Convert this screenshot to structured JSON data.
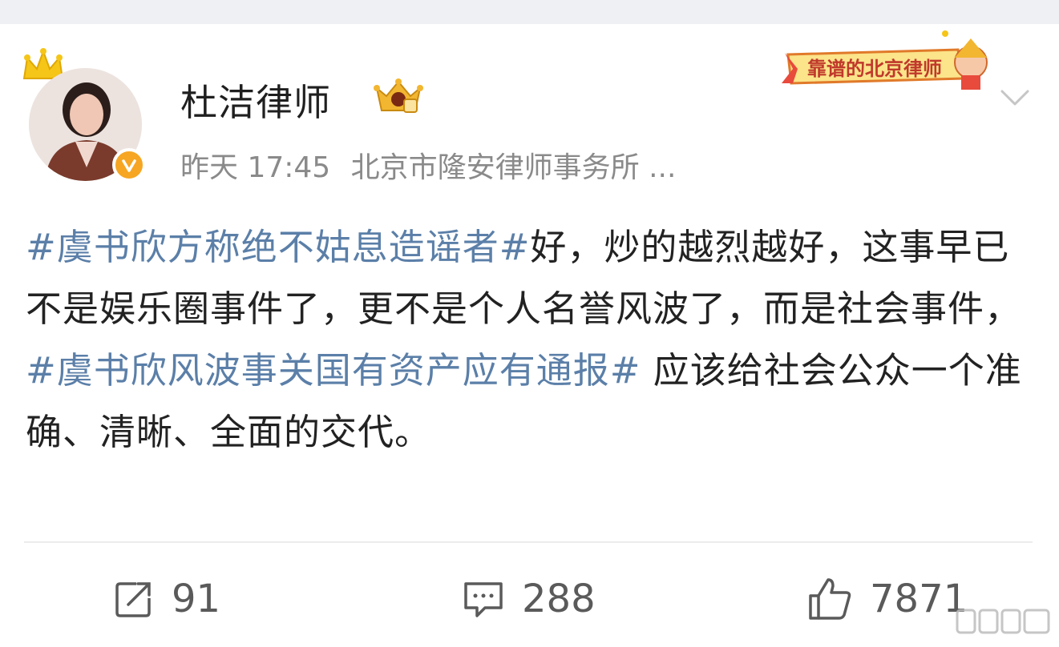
{
  "user": {
    "name": "杜洁律师",
    "time": "昨天 17:45",
    "source": "北京市隆安律师事务所 ..."
  },
  "badge": {
    "text": "靠谱的北京律师"
  },
  "post": {
    "segments": [
      {
        "text": "#虞书欣方称绝不姑息造谣者#",
        "hashtag": true
      },
      {
        "text": "好，炒的越烈越好，这事早已不是娱乐圈事件了，更不是个人名誉风波了，而是社会事件，",
        "hashtag": false
      },
      {
        "text": "#虞书欣风波事关国有资产应有通报#",
        "hashtag": true
      },
      {
        "text": " 应该给社会公众一个准确、清晰、全面的交代。",
        "hashtag": false
      }
    ]
  },
  "actions": {
    "repost": {
      "icon": "repost-icon",
      "count": "91"
    },
    "comment": {
      "icon": "comment-icon",
      "count": "288"
    },
    "like": {
      "icon": "thumbs-up-icon",
      "count": "7871"
    }
  },
  "colors": {
    "hashtag": "#5b7fa8",
    "verified": "#f6a623",
    "text": "#222222",
    "meta": "#8a8a8a"
  }
}
